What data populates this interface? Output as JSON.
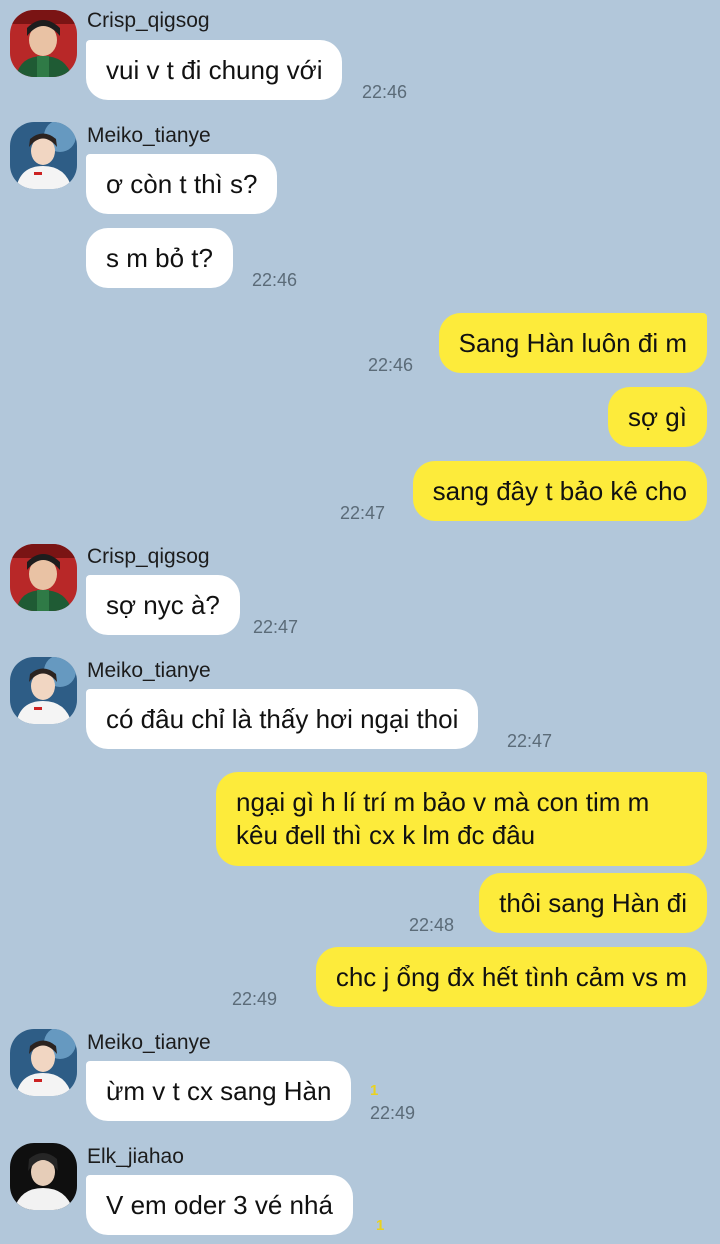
{
  "users": {
    "crisp": "Crisp_qigsog",
    "meiko": "Meiko_tianye",
    "elk": "Elk_jiahao"
  },
  "messages": {
    "m1": {
      "text": "vui v t đi chung với",
      "time": "22:46"
    },
    "m2": {
      "text": "ơ còn t thì s?"
    },
    "m3": {
      "text": "s m bỏ t?",
      "time": "22:46"
    },
    "m4": {
      "text": "Sang Hàn luôn đi m",
      "time": "22:46"
    },
    "m5": {
      "text": "sợ gì"
    },
    "m6": {
      "text": "sang đây t bảo kê cho",
      "time": "22:47"
    },
    "m7": {
      "text": "sợ nyc à?",
      "time": "22:47"
    },
    "m8": {
      "text": "có đâu chỉ là thấy hơi ngại thoi",
      "time": "22:47"
    },
    "m9": {
      "text": "ngại gì h lí trí m bảo v mà con tim m kêu đell thì cx k lm đc đâu"
    },
    "m10": {
      "text": "thôi sang Hàn đi",
      "time": "22:48"
    },
    "m11": {
      "text": "chc j ổng đx hết tình cảm vs m",
      "time": "22:49"
    },
    "m12": {
      "text": "ừm v t cx sang Hàn",
      "time": "22:49",
      "unread": "1"
    },
    "m13": {
      "text": "V em oder 3 vé nhá",
      "unread": "1"
    }
  },
  "colors": {
    "background": "#b2c7da",
    "incoming_bubble": "#ffffff",
    "outgoing_bubble": "#fdeb3b",
    "unread_count": "#e9d21f"
  }
}
